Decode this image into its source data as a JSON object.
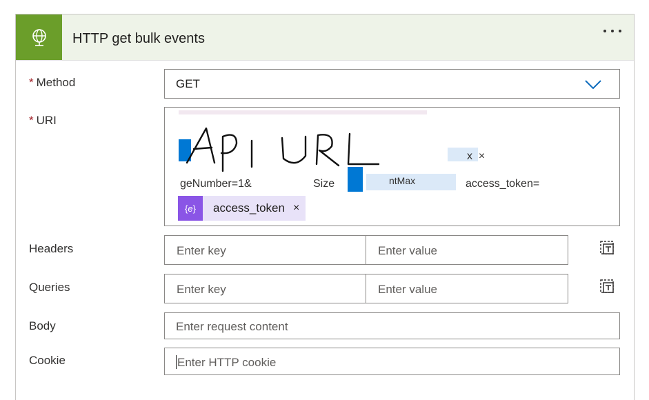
{
  "card": {
    "title": "HTTP get bulk events",
    "icon": "globe-icon",
    "more_icon": "more-options-icon",
    "accent": "#6b9e2a"
  },
  "method": {
    "required": "*",
    "label": "Method",
    "value": "GET"
  },
  "uri": {
    "required": "*",
    "label": "URI",
    "handwritten_overlay": "API URL",
    "visible_fragments": {
      "line2_x": "x",
      "line3_left": "geNumber=1&",
      "line3_mid": "Size",
      "line3_tag": "ntMax",
      "line3_right": "access_token="
    },
    "token": {
      "icon": "dynamic-content-icon",
      "label": "access_token",
      "remove": "×"
    }
  },
  "headers": {
    "label": "Headers",
    "key_placeholder": "Enter key",
    "value_placeholder": "Enter value",
    "switch_icon": "text-mode-icon"
  },
  "queries": {
    "label": "Queries",
    "key_placeholder": "Enter key",
    "value_placeholder": "Enter value",
    "switch_icon": "text-mode-icon"
  },
  "body": {
    "label": "Body",
    "placeholder": "Enter request content"
  },
  "cookie": {
    "label": "Cookie",
    "placeholder": "Enter HTTP cookie"
  }
}
